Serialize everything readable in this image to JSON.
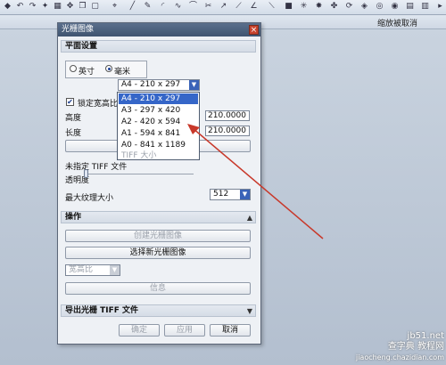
{
  "command_bar": {
    "label": "缩放被取消"
  },
  "dialog": {
    "title": "光栅图像",
    "close_glyph": "×",
    "sections": {
      "plane": "平面设置",
      "operations": "操作",
      "export": "导出光栅 TIFF 文件"
    },
    "units": {
      "inch": "英寸",
      "mm": "毫米",
      "selected": "毫米"
    },
    "paper_select": {
      "value": "A4 - 210 x 297"
    },
    "lock_aspect": {
      "label": "锁定宽高比",
      "checked": true
    },
    "height": {
      "label": "高度",
      "value": "210.0000"
    },
    "length": {
      "label": "长度",
      "value": "210.0000"
    },
    "tiff_status": "未指定 TIFF 文件",
    "transparency_label": "透明度",
    "max_texture": {
      "label": "最大纹理大小",
      "value": "512"
    },
    "create_button": "创建光栅图像",
    "select_new_button": "选择新光栅图像",
    "aspect_select": "宽高比",
    "info_button": "信息",
    "footer": {
      "ok": "确定",
      "apply": "应用",
      "cancel": "取消"
    }
  },
  "dropdown_options": [
    "A4 - 210 x 297",
    "A3 - 297 x 420",
    "A2 - 420 x 594",
    "A1 - 594 x 841",
    "A0 - 841 x 1189",
    "TIFF 大小"
  ],
  "watermark": {
    "line1": "jb51.net",
    "line2": "查字典 教程网",
    "line3": "jiaocheng.chazidian.com"
  },
  "colors": {
    "arrow": "#c8382a",
    "selection": "#3566c8",
    "titlebar": "#4a6080"
  }
}
